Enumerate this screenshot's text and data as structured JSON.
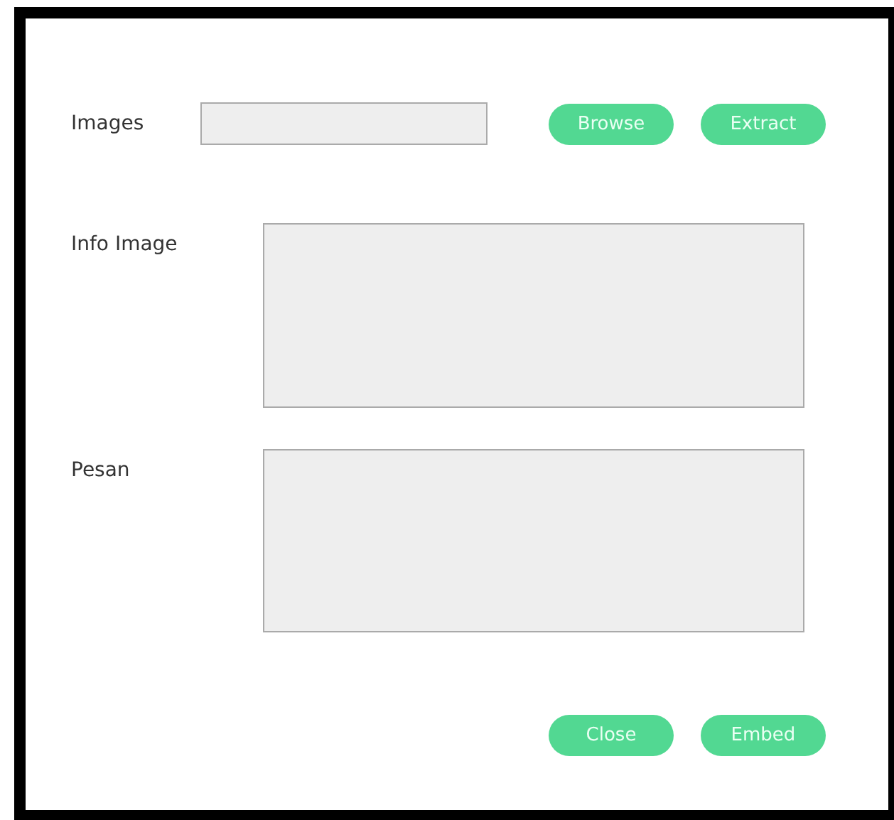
{
  "images": {
    "label": "Images"
  },
  "top_buttons": [
    "Browse",
    "Extract"
  ],
  "info_image": {
    "label": "Info Image"
  },
  "pesan": {
    "label": "Pesan"
  },
  "bottom_buttons": [
    "Close",
    "Embed"
  ]
}
